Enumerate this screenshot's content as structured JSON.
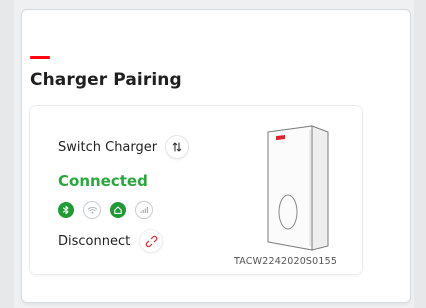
{
  "page": {
    "title": "Charger Pairing"
  },
  "charger_card": {
    "switch_label": "Switch Charger",
    "status": "Connected",
    "status_color": "#2aa83e",
    "connectivity": [
      {
        "name": "bluetooth-icon",
        "active": true
      },
      {
        "name": "wifi-icon",
        "active": false
      },
      {
        "name": "home-network-icon",
        "active": true
      },
      {
        "name": "cellular-icon",
        "active": false
      }
    ],
    "disconnect_label": "Disconnect",
    "serial": "TACW2242020S0155"
  },
  "colors": {
    "accent": "#ff000f",
    "active_icon": "#1f9a34"
  }
}
